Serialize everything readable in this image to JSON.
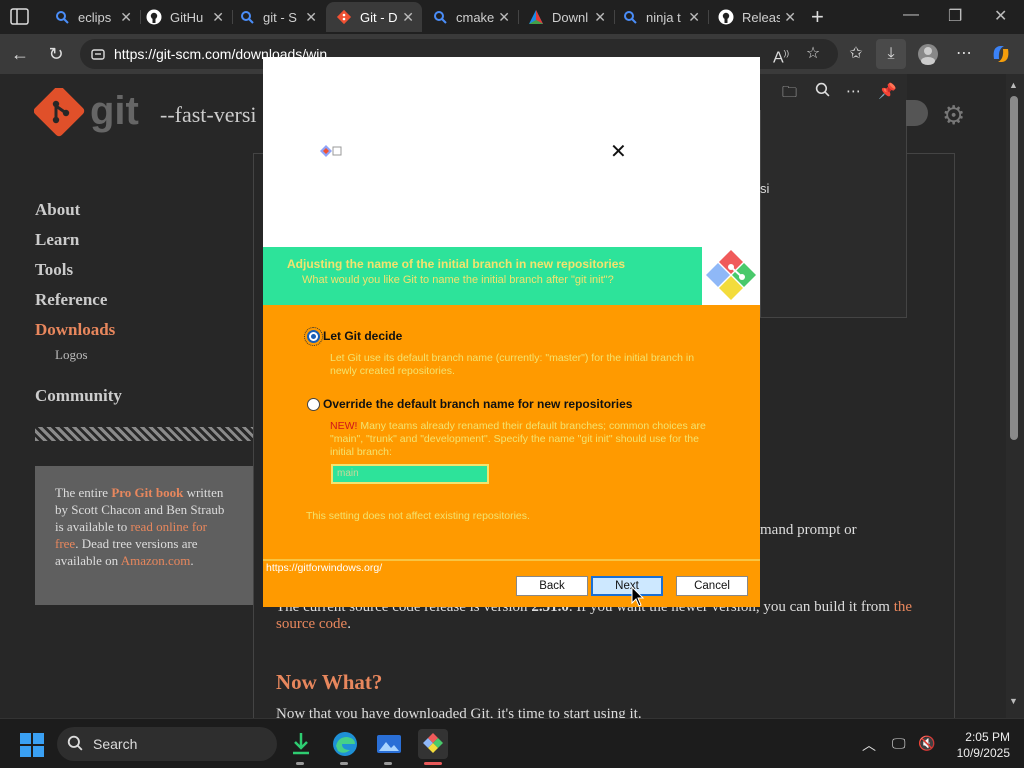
{
  "browser": {
    "tabs": [
      {
        "label": "eclips",
        "icon": "search-icon"
      },
      {
        "label": "GitHu",
        "icon": "github-icon"
      },
      {
        "label": "git - S",
        "icon": "search-icon"
      },
      {
        "label": "Git - D",
        "icon": "git-icon"
      },
      {
        "label": "cmake",
        "icon": "search-icon"
      },
      {
        "label": "Downl",
        "icon": "cmake-icon"
      },
      {
        "label": "ninja t",
        "icon": "search-icon"
      },
      {
        "label": "Releas",
        "icon": "github-icon"
      }
    ],
    "url": "https://git-scm.com/downloads/win"
  },
  "website": {
    "tagline": "--fast-versi",
    "nav": [
      "About",
      "Learn",
      "Tools",
      "Reference",
      "Downloads",
      "Logos",
      "Community"
    ],
    "progit": {
      "p1": "The entire ",
      "book": "Pro Git book",
      "p2": " written by Scott Chacon and Ben Straub is available to ",
      "read": "read online for free",
      "p3": ". Dead tree versions are available on ",
      "amazon": "Amazon.com",
      "p4": "."
    },
    "cut_right_1": "si",
    "cut_right_2": "mand prompt or",
    "release_line_pre": "The current source code release is version ",
    "release_version": "2.51.0",
    "release_line_post": ". If you want the newer version, you can build it from ",
    "release_link": "the",
    "source_code": "source code",
    "source_post": ".",
    "now_what": "Now What?",
    "now_text": "Now that you have downloaded Git, it's time to start using it."
  },
  "dialog": {
    "header_title": "Adjusting the name of the initial branch in new repositories",
    "header_subtitle": "What would you like Git to name the initial branch after \"git init\"?",
    "option1_label": "Let Git decide",
    "option1_desc": "Let Git use its default branch name (currently: \"master\") for the initial branch in newly created repositories.",
    "option2_label": "Override the default branch name for new repositories",
    "option2_new": "NEW!",
    "option2_desc": " Many teams already renamed their default branches; common choices are \"main\", \"trunk\" and \"development\". Specify the name \"git init\" should use for the initial branch:",
    "branch_placeholder": "main",
    "note": "This setting does not affect existing repositories.",
    "footer_link": "https://gitforwindows.org/",
    "back": "Back",
    "next": "Next",
    "cancel": "Cancel"
  },
  "taskbar": {
    "search": "Search",
    "time": "2:05 PM",
    "date": "10/9/2025"
  },
  "colors": {
    "accent": "#e8875d",
    "dialog_green": "#2de39a",
    "dialog_orange": "#ff9a00",
    "dialog_yellow_text": "#f3e36e"
  }
}
